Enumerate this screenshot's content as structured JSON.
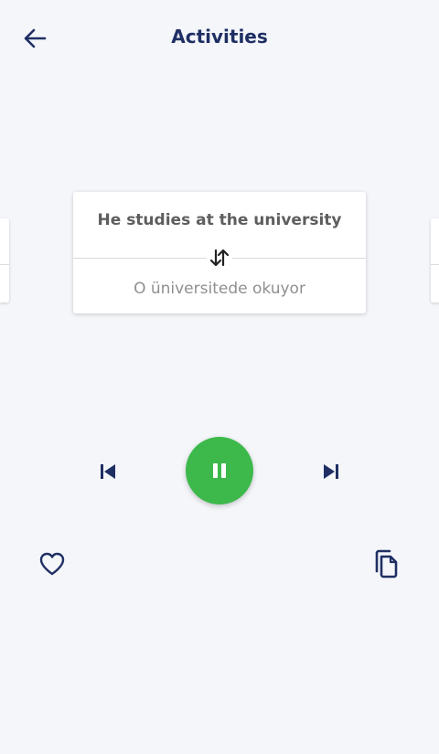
{
  "header": {
    "title": "Activities",
    "back_icon": "arrow-left-icon"
  },
  "card": {
    "front_text": "He studies at the university",
    "back_text": "O üniversitede okuyor",
    "swap_icon": "swap-vertical-icon"
  },
  "player": {
    "prev_icon": "skip-previous-icon",
    "play_state_icon": "pause-icon",
    "next_icon": "skip-next-icon",
    "play_button_color": "#3cb94a"
  },
  "actions": {
    "favorite_icon": "heart-outline-icon",
    "copy_icon": "copy-icon"
  },
  "colors": {
    "primary": "#1f2f63",
    "background": "#f4f6fa",
    "card_front_text": "#5e5e5e",
    "card_back_text": "#8f8f8f"
  }
}
